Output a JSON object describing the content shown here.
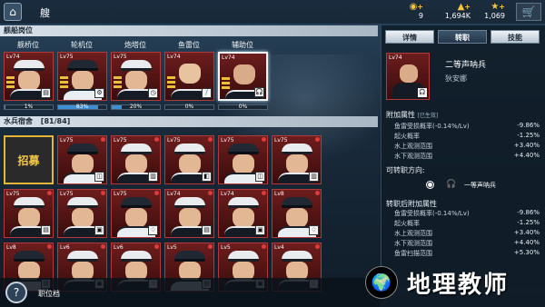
{
  "topbar": {
    "title": "艘",
    "resources": [
      {
        "icon": "gold-coin-icon",
        "value": "9"
      },
      {
        "icon": "oil-icon",
        "value": "1,694K"
      },
      {
        "icon": "star-icon",
        "value": "1,069"
      }
    ]
  },
  "ship_positions": {
    "header": "舰船岗位",
    "labels": [
      "舰桥位",
      "轮机位",
      "炮塔位",
      "鱼雷位",
      "辅助位"
    ],
    "crew": [
      {
        "lv": "Lv74",
        "progress": 1,
        "progress_label": "1%"
      },
      {
        "lv": "Lv75",
        "progress": 83,
        "progress_label": "83%"
      },
      {
        "lv": "Lv75",
        "progress": 20,
        "progress_label": "20%"
      },
      {
        "lv": "Lv74",
        "progress": 0,
        "progress_label": "0%"
      },
      {
        "lv": "Lv74",
        "progress": 0,
        "progress_label": "0%"
      }
    ]
  },
  "barracks": {
    "header": "水兵宿舍",
    "count": "[81/84]",
    "recruit_label": "招募",
    "row1": [
      "Lv75",
      "Lv75",
      "Lv75",
      "Lv75",
      "Lv75"
    ],
    "row2": [
      "Lv75",
      "Lv75",
      "Lv75",
      "Lv74",
      "Lv74",
      "Lv8"
    ],
    "row3": [
      "Lv8",
      "Lv6",
      "Lv6",
      "Lv5",
      "Lv5",
      "Lv4"
    ]
  },
  "panel": {
    "tabs": [
      "详情",
      "转职",
      "技能"
    ],
    "active_tab": 1,
    "name": "二等声呐兵",
    "rank": "狄安娜",
    "bonus_title": "附加属性",
    "bonus_note": "[已生效]",
    "bonus_attrs": [
      {
        "label": "鱼雷受损概率(-0.14%/Lv)",
        "value": "-9.86%"
      },
      {
        "label": "起火概率",
        "value": "-1.25%"
      },
      {
        "label": "水上观测范围",
        "value": "+3.40%"
      },
      {
        "label": "水下观测范围",
        "value": "+4.40%"
      }
    ],
    "transfer_title": "可转职方向:",
    "transfer_option": "一等声呐兵",
    "after_title": "转职后附加属性",
    "after_attrs": [
      {
        "label": "鱼雷受损概率(-0.14%/Lv)",
        "value": "-9.86%"
      },
      {
        "label": "起火概率",
        "value": "-1.25%"
      },
      {
        "label": "水上观测范围",
        "value": "+3.40%"
      },
      {
        "label": "水下观测范围",
        "value": "+4.40%"
      },
      {
        "label": "鱼雷扫描范围",
        "value": "+5.30%"
      }
    ]
  },
  "bottom": {
    "help": "?",
    "duty_label": "职位档"
  },
  "watermark": {
    "text": "地理教师"
  },
  "colors": {
    "card_red": "#6d1d1d",
    "accent_gold": "#f3c847",
    "progress_blue": "#3c8fd6"
  }
}
